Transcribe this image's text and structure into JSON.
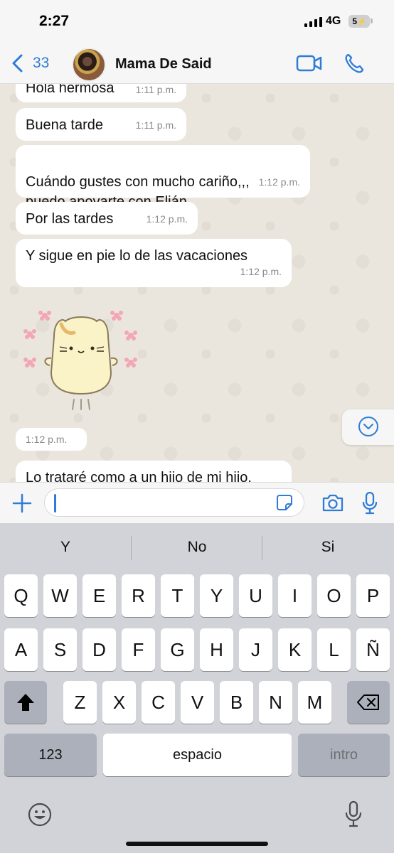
{
  "status_bar": {
    "time": "2:27",
    "network": "4G",
    "battery": "5"
  },
  "header": {
    "back_count": "33",
    "contact_name": "Mama De Said"
  },
  "messages": [
    {
      "text": "Hola hermosa",
      "time": "1:11 p.m."
    },
    {
      "text": "Buena tarde",
      "time": "1:11 p.m."
    },
    {
      "text": "Cuándo gustes con mucho cariño,,,\npuedo apoyarte con Elián",
      "time": "1:12 p.m."
    },
    {
      "text": "Por las tardes",
      "time": "1:12 p.m."
    },
    {
      "text": "Y sigue en pie lo de las vacaciones",
      "time": "1:12 p.m."
    },
    {
      "text": "",
      "time": "1:12 p.m."
    },
    {
      "text": "Lo trataré como a un hijo de mi hijo.",
      "time": ""
    }
  ],
  "input": {
    "placeholder": ""
  },
  "keyboard": {
    "suggestions": [
      "Y",
      "No",
      "Si"
    ],
    "row1": [
      "Q",
      "W",
      "E",
      "R",
      "T",
      "Y",
      "U",
      "I",
      "O",
      "P"
    ],
    "row2": [
      "A",
      "S",
      "D",
      "F",
      "G",
      "H",
      "J",
      "K",
      "L",
      "Ñ"
    ],
    "row3": [
      "Z",
      "X",
      "C",
      "V",
      "B",
      "N",
      "M"
    ],
    "numbers_label": "123",
    "space_label": "espacio",
    "return_label": "intro"
  },
  "icons": [
    "chevron-left-icon",
    "video-call-icon",
    "phone-icon",
    "plus-icon",
    "sticker-icon",
    "camera-icon",
    "mic-icon",
    "chevron-down-icon",
    "shift-icon",
    "backspace-icon",
    "emoji-icon",
    "dictation-mic-icon"
  ],
  "colors": {
    "accent": "#2f7cd6",
    "chat_background": "#ebe6dd",
    "bubble": "#ffffff",
    "keyboard": "#d1d3d9"
  }
}
